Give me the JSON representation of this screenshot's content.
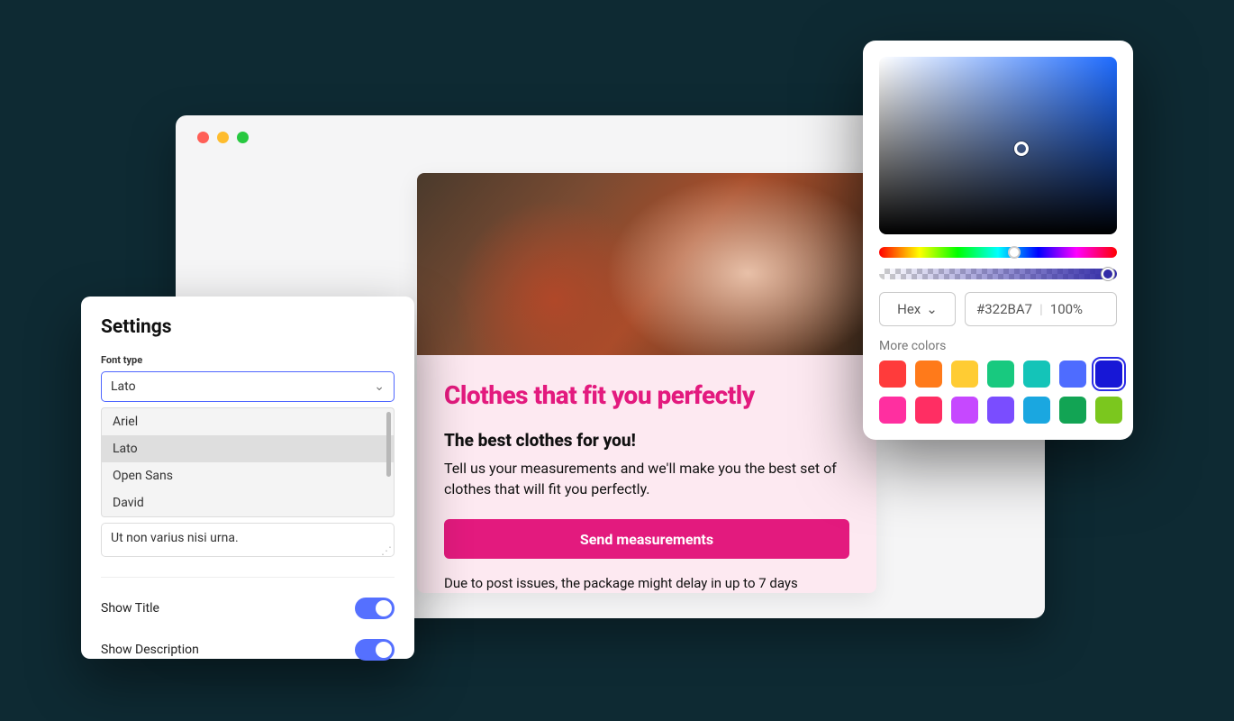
{
  "browser": {
    "card": {
      "title": "Clothes that fit you perfectly",
      "subtitle": "The best clothes for you!",
      "description": "Tell us your measurements and we'll make you the best set of clothes that will fit you perfectly.",
      "button": "Send measurements",
      "note": "Due to post issues, the package might delay in up to 7 days"
    }
  },
  "settings": {
    "title": "Settings",
    "font_type_label": "Font type",
    "font_selected": "Lato",
    "font_options": [
      "Ariel",
      "Lato",
      "Open Sans",
      "David"
    ],
    "textarea_value": "Ut non varius nisi urna.",
    "toggles": {
      "show_title": {
        "label": "Show Title",
        "value": true
      },
      "show_description": {
        "label": "Show Description",
        "value": true
      }
    }
  },
  "picker": {
    "format_label": "Hex",
    "hex_value": "#322BA7",
    "opacity_label": "100%",
    "more_colors_label": "More colors",
    "swatches": [
      {
        "color": "#ff3b3b",
        "selected": false
      },
      {
        "color": "#ff7a1a",
        "selected": false
      },
      {
        "color": "#ffcc33",
        "selected": false
      },
      {
        "color": "#18c97f",
        "selected": false
      },
      {
        "color": "#14c4b8",
        "selected": false
      },
      {
        "color": "#4e6cff",
        "selected": false
      },
      {
        "color": "#1717d6",
        "selected": true
      },
      {
        "color": "#ff2fa0",
        "selected": false
      },
      {
        "color": "#ff2e63",
        "selected": false
      },
      {
        "color": "#c648ff",
        "selected": false
      },
      {
        "color": "#7a4dff",
        "selected": false
      },
      {
        "color": "#1aa7e0",
        "selected": false
      },
      {
        "color": "#12a454",
        "selected": false
      },
      {
        "color": "#7bc71e",
        "selected": false
      }
    ]
  }
}
